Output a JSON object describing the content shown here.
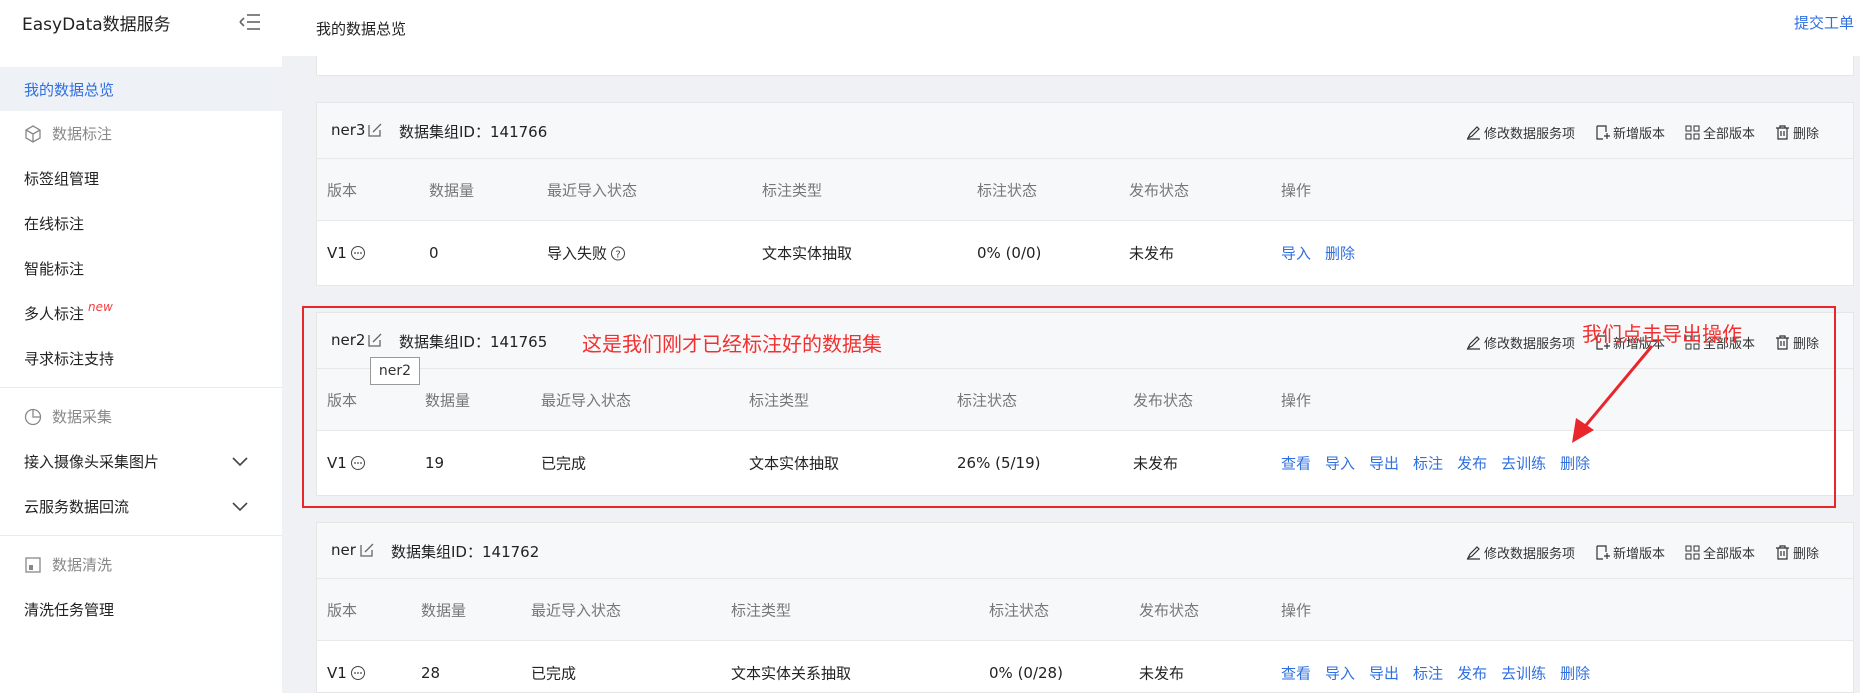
{
  "sidebar": {
    "brand": "EasyData数据服务",
    "active_item": "我的数据总览",
    "sections": [
      {
        "title": "数据标注",
        "items": [
          "标签组管理",
          "在线标注",
          "智能标注",
          "多人标注",
          "寻求标注支持"
        ],
        "badge": "new"
      },
      {
        "title": "数据采集",
        "items": [
          "接入摄像头采集图片",
          "云服务数据回流"
        ]
      },
      {
        "title": "数据清洗",
        "items": [
          "清洗任务管理"
        ]
      }
    ]
  },
  "topbar": {
    "title": "我的数据总览",
    "link": "提交工单"
  },
  "actions": {
    "edit": "修改数据服务项",
    "new_version": "新增版本",
    "all_versions": "全部版本",
    "delete": "删除"
  },
  "columns": [
    "版本",
    "数据量",
    "最近导入状态",
    "标注类型",
    "标注状态",
    "发布状态",
    "操作"
  ],
  "group_id_label": "数据集组ID：",
  "cards": [
    {
      "name": "ner3",
      "group_id": "141766",
      "row": {
        "version": "V1",
        "count": "0",
        "import_status": "导入失败",
        "label_type": "文本实体抽取",
        "label_status": "0% (0/0)",
        "publish": "未发布",
        "ops": [
          "导入",
          "删除"
        ]
      }
    },
    {
      "name": "ner2",
      "group_id": "141765",
      "row": {
        "version": "V1",
        "count": "19",
        "import_status": "已完成",
        "label_type": "文本实体抽取",
        "label_status": "26% (5/19)",
        "publish": "未发布",
        "ops": [
          "查看",
          "导入",
          "导出",
          "标注",
          "发布",
          "去训练",
          "删除"
        ]
      }
    },
    {
      "name": "ner",
      "group_id": "141762",
      "row": {
        "version": "V1",
        "count": "28",
        "import_status": "已完成",
        "label_type": "文本实体关系抽取",
        "label_status": "0% (0/28)",
        "publish": "未发布",
        "ops": [
          "查看",
          "导入",
          "导出",
          "标注",
          "发布",
          "去训练",
          "删除"
        ]
      }
    }
  ],
  "tooltip": "ner2",
  "annotations": {
    "note1": "这是我们刚才已经标注好的数据集",
    "note2": "我们点击导出操作"
  },
  "colors": {
    "accent": "#2f6fe0",
    "annotation": "#e8262b"
  }
}
